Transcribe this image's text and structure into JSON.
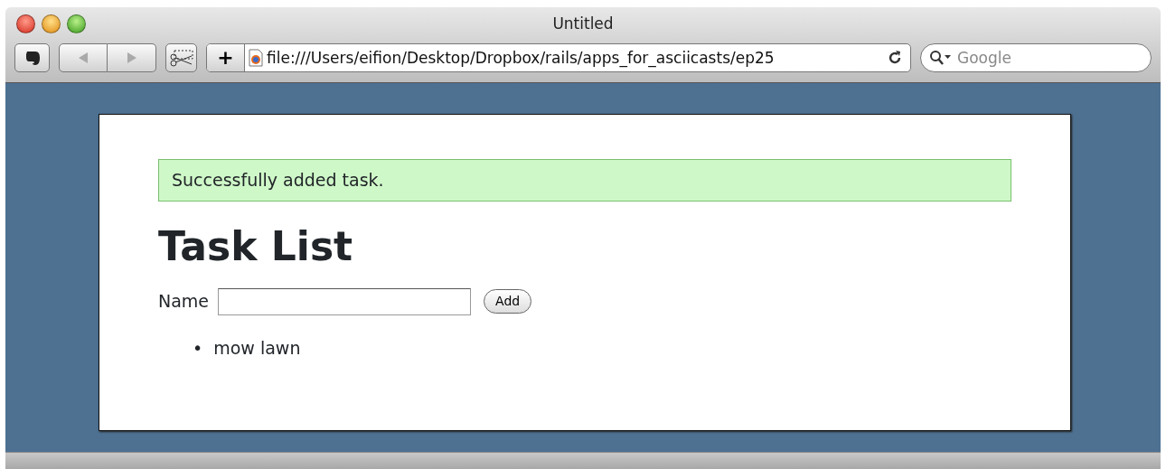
{
  "window": {
    "title": "Untitled"
  },
  "toolbar": {
    "url": "file:///Users/eifion/Desktop/Dropbox/rails/apps_for_asciicasts/ep25",
    "search": {
      "placeholder": "Google"
    },
    "add_tab": "+"
  },
  "page": {
    "flash": "Successfully added task.",
    "heading": "Task List",
    "form": {
      "label": "Name",
      "button": "Add"
    },
    "tasks": [
      {
        "bullet": "•",
        "text": "mow lawn"
      }
    ]
  }
}
